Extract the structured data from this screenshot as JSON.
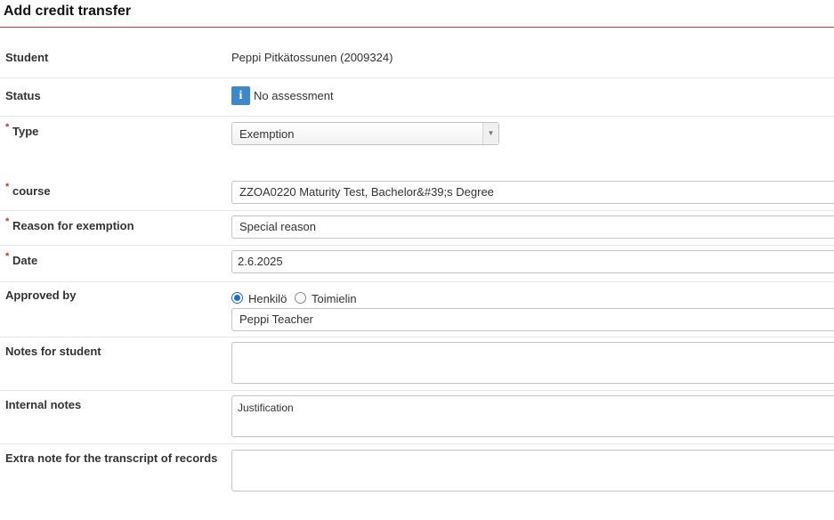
{
  "page": {
    "title": "Add credit transfer"
  },
  "student": {
    "label": "Student",
    "value": "Peppi Pitkätossunen (2009324)"
  },
  "status": {
    "label": "Status",
    "icon": "info-icon",
    "icon_glyph": "i",
    "value": "No assessment"
  },
  "type": {
    "label": "Type",
    "required_mark": "*",
    "selected": "Exemption",
    "arrow": "▼"
  },
  "course": {
    "label": "course",
    "required_mark": "*",
    "value": "ZZOA0220 Maturity Test, Bachelor&#39;s Degree"
  },
  "reason": {
    "label": "Reason for exemption",
    "required_mark": "*",
    "value": "Special reason"
  },
  "date": {
    "label": "Date",
    "required_mark": "*",
    "value": "2.6.2025"
  },
  "approved_by": {
    "label": "Approved by",
    "options": [
      {
        "label": "Henkilö",
        "checked": true
      },
      {
        "label": "Toimielin",
        "checked": false
      }
    ],
    "value": "Peppi Teacher"
  },
  "notes_for_student": {
    "label": "Notes for student",
    "value": ""
  },
  "internal_notes": {
    "label": "Internal notes",
    "value": "Justification"
  },
  "extra_note": {
    "label": "Extra note for the transcript of records",
    "value": ""
  },
  "colors": {
    "accent": "#b33a3a",
    "required": "#c0392b",
    "info": "#3d88c8",
    "radio": "#1a6ed8"
  }
}
